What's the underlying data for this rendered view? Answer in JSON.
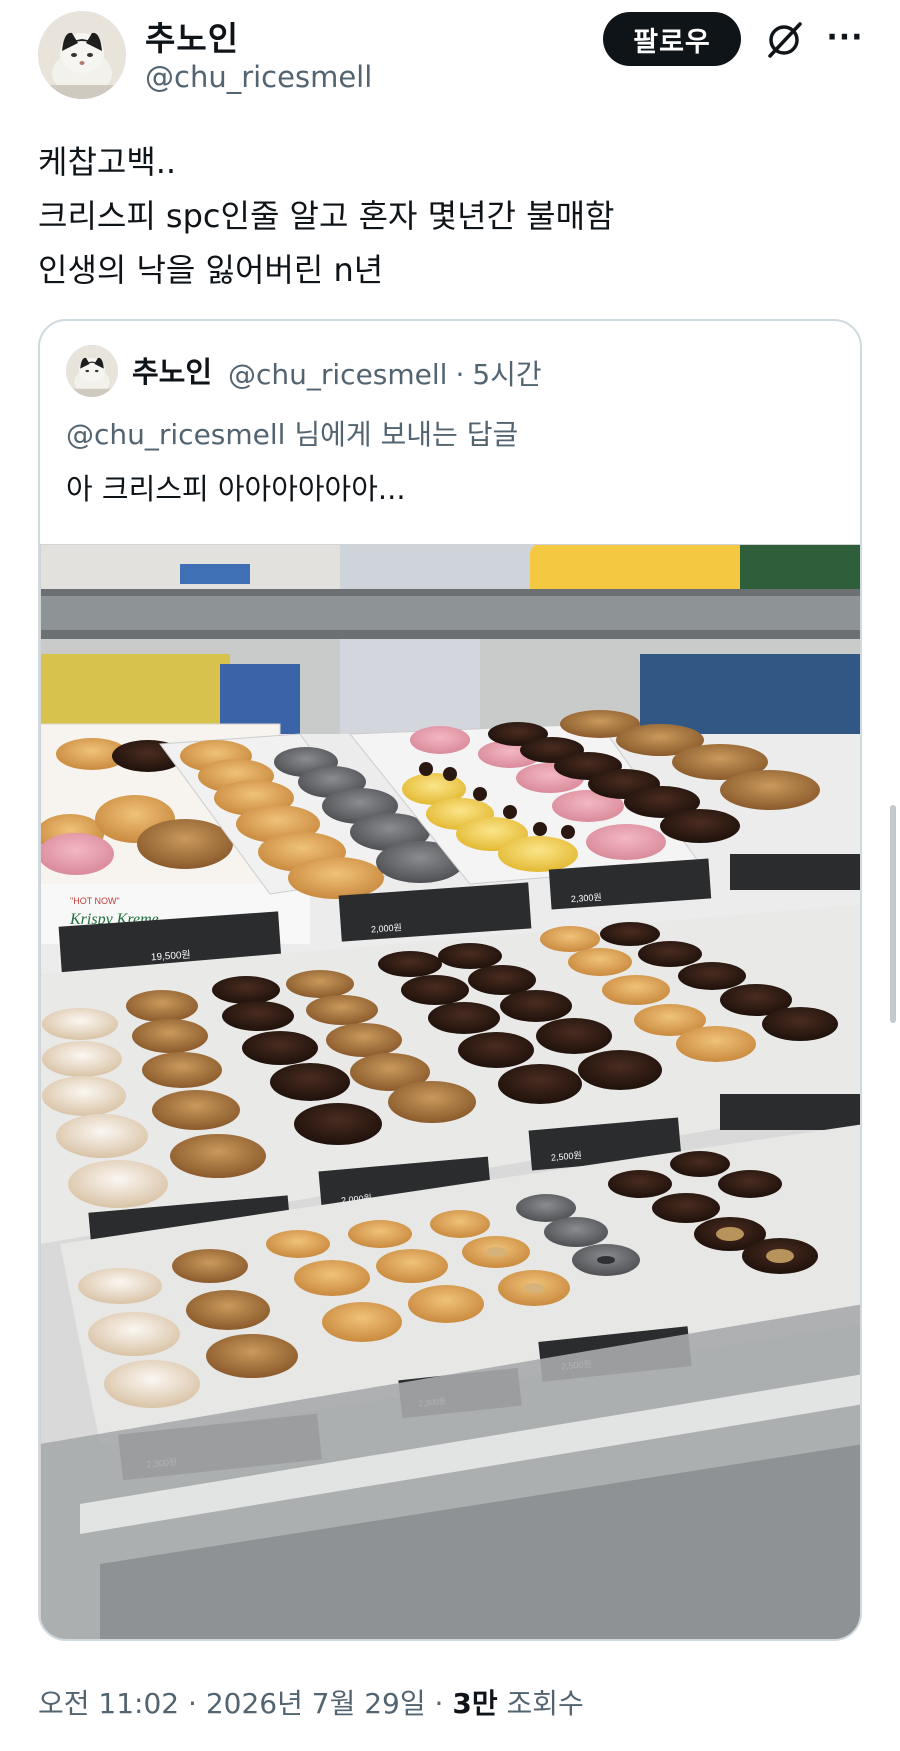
{
  "author": {
    "name": "추노인",
    "handle": "@chu_ricesmell",
    "avatar_icon": "cat-avatar"
  },
  "actions": {
    "follow_label": "팔로우",
    "grok_icon": "grok-icon",
    "more_label": "···"
  },
  "tweet": {
    "lines": [
      "케찹고백..",
      "크리스피 spc인줄 알고 혼자 몇년간 불매함",
      "인생의 낙을 잃어버린 n년"
    ]
  },
  "quote": {
    "name": "추노인",
    "handle": "@chu_ricesmell",
    "separator": "·",
    "time": "5시간",
    "reply_to": "@chu_ricesmell 님에게 보내는 답글",
    "text": "아 크리스피 아아아아아아...",
    "photo": {
      "labels": {
        "hot_now": "\"HOT NOW\"",
        "brand": "Krispy Kreme",
        "price_a": "19,500원",
        "price_b": "2,000원",
        "price_c": "2,300원",
        "price_d": "2,500원"
      }
    }
  },
  "meta": {
    "time": "오전 11:02",
    "sep1": "·",
    "date": "2026년 7월 29일",
    "sep2": "·",
    "views_count": "3만",
    "views_label": "조회수"
  },
  "colors": {
    "text_primary": "#0f1419",
    "text_secondary": "#536471",
    "border": "#cfd9de",
    "follow_bg": "#0f1419"
  }
}
